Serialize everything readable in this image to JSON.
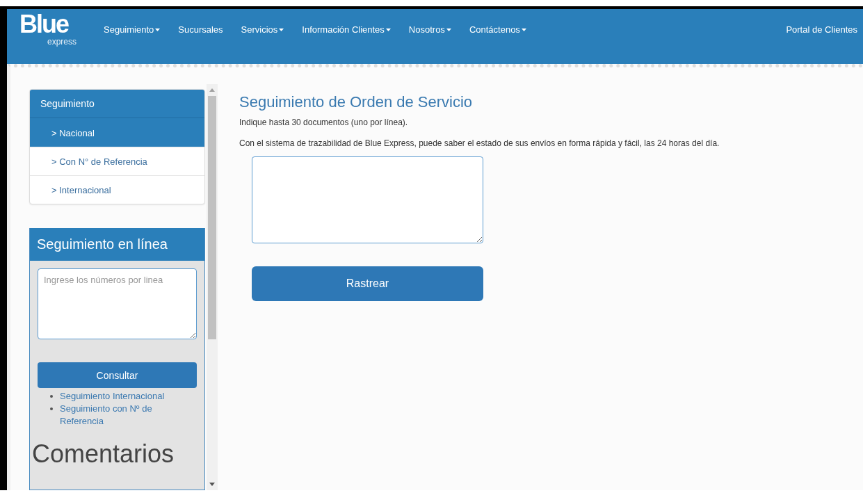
{
  "navbar": {
    "logo": {
      "name": "Blue",
      "tagline": "express"
    },
    "items": [
      {
        "label": "Seguimiento",
        "dropdown": true
      },
      {
        "label": "Sucursales",
        "dropdown": false
      },
      {
        "label": "Servicios",
        "dropdown": true
      },
      {
        "label": "Información Clientes",
        "dropdown": true
      },
      {
        "label": "Nosotros",
        "dropdown": true
      },
      {
        "label": "Contáctenos",
        "dropdown": true
      }
    ],
    "right_link": "Portal de Clientes"
  },
  "sidebar": {
    "menu": {
      "title": "Seguimiento",
      "items": [
        {
          "label": "> Nacional",
          "selected": true
        },
        {
          "label": "> Con N° de Referencia",
          "selected": false
        },
        {
          "label": "> Internacional",
          "selected": false
        }
      ]
    },
    "tracking": {
      "title": "Seguimiento en línea",
      "placeholder": "Ingrese los números por linea",
      "button": "Consultar",
      "links": [
        "Seguimiento Internacional",
        "Seguimiento con Nº de Referencia"
      ]
    },
    "comments_title": "Comentarios"
  },
  "main": {
    "title": "Seguimiento de Orden de Servicio",
    "hint": "Indique hasta 30 documentos (uno por línea).",
    "description": "Con el sistema de trazabilidad de Blue Express, puede saber el estado de sus envíos en forma rápida y fácil, las 24 horas del día.",
    "button": "Rastrear"
  }
}
